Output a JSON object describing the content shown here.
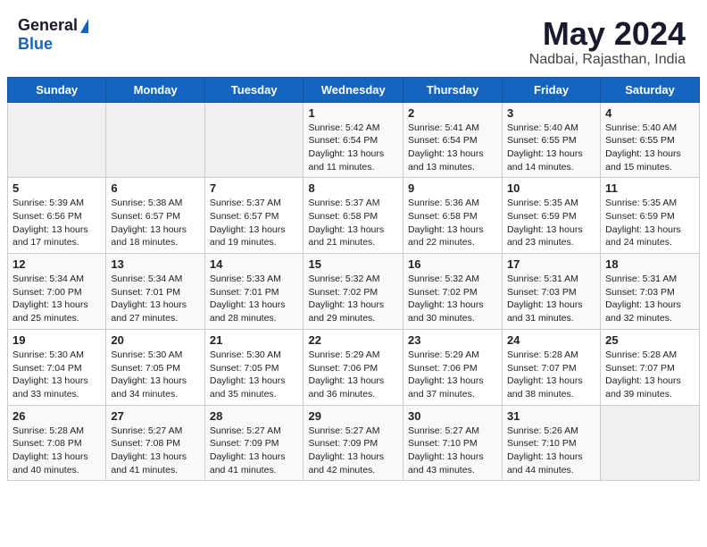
{
  "header": {
    "logo_general": "General",
    "logo_blue": "Blue",
    "title": "May 2024",
    "subtitle": "Nadbai, Rajasthan, India"
  },
  "weekdays": [
    "Sunday",
    "Monday",
    "Tuesday",
    "Wednesday",
    "Thursday",
    "Friday",
    "Saturday"
  ],
  "weeks": [
    [
      {
        "day": "",
        "info": ""
      },
      {
        "day": "",
        "info": ""
      },
      {
        "day": "",
        "info": ""
      },
      {
        "day": "1",
        "info": "Sunrise: 5:42 AM\nSunset: 6:54 PM\nDaylight: 13 hours\nand 11 minutes."
      },
      {
        "day": "2",
        "info": "Sunrise: 5:41 AM\nSunset: 6:54 PM\nDaylight: 13 hours\nand 13 minutes."
      },
      {
        "day": "3",
        "info": "Sunrise: 5:40 AM\nSunset: 6:55 PM\nDaylight: 13 hours\nand 14 minutes."
      },
      {
        "day": "4",
        "info": "Sunrise: 5:40 AM\nSunset: 6:55 PM\nDaylight: 13 hours\nand 15 minutes."
      }
    ],
    [
      {
        "day": "5",
        "info": "Sunrise: 5:39 AM\nSunset: 6:56 PM\nDaylight: 13 hours\nand 17 minutes."
      },
      {
        "day": "6",
        "info": "Sunrise: 5:38 AM\nSunset: 6:57 PM\nDaylight: 13 hours\nand 18 minutes."
      },
      {
        "day": "7",
        "info": "Sunrise: 5:37 AM\nSunset: 6:57 PM\nDaylight: 13 hours\nand 19 minutes."
      },
      {
        "day": "8",
        "info": "Sunrise: 5:37 AM\nSunset: 6:58 PM\nDaylight: 13 hours\nand 21 minutes."
      },
      {
        "day": "9",
        "info": "Sunrise: 5:36 AM\nSunset: 6:58 PM\nDaylight: 13 hours\nand 22 minutes."
      },
      {
        "day": "10",
        "info": "Sunrise: 5:35 AM\nSunset: 6:59 PM\nDaylight: 13 hours\nand 23 minutes."
      },
      {
        "day": "11",
        "info": "Sunrise: 5:35 AM\nSunset: 6:59 PM\nDaylight: 13 hours\nand 24 minutes."
      }
    ],
    [
      {
        "day": "12",
        "info": "Sunrise: 5:34 AM\nSunset: 7:00 PM\nDaylight: 13 hours\nand 25 minutes."
      },
      {
        "day": "13",
        "info": "Sunrise: 5:34 AM\nSunset: 7:01 PM\nDaylight: 13 hours\nand 27 minutes."
      },
      {
        "day": "14",
        "info": "Sunrise: 5:33 AM\nSunset: 7:01 PM\nDaylight: 13 hours\nand 28 minutes."
      },
      {
        "day": "15",
        "info": "Sunrise: 5:32 AM\nSunset: 7:02 PM\nDaylight: 13 hours\nand 29 minutes."
      },
      {
        "day": "16",
        "info": "Sunrise: 5:32 AM\nSunset: 7:02 PM\nDaylight: 13 hours\nand 30 minutes."
      },
      {
        "day": "17",
        "info": "Sunrise: 5:31 AM\nSunset: 7:03 PM\nDaylight: 13 hours\nand 31 minutes."
      },
      {
        "day": "18",
        "info": "Sunrise: 5:31 AM\nSunset: 7:03 PM\nDaylight: 13 hours\nand 32 minutes."
      }
    ],
    [
      {
        "day": "19",
        "info": "Sunrise: 5:30 AM\nSunset: 7:04 PM\nDaylight: 13 hours\nand 33 minutes."
      },
      {
        "day": "20",
        "info": "Sunrise: 5:30 AM\nSunset: 7:05 PM\nDaylight: 13 hours\nand 34 minutes."
      },
      {
        "day": "21",
        "info": "Sunrise: 5:30 AM\nSunset: 7:05 PM\nDaylight: 13 hours\nand 35 minutes."
      },
      {
        "day": "22",
        "info": "Sunrise: 5:29 AM\nSunset: 7:06 PM\nDaylight: 13 hours\nand 36 minutes."
      },
      {
        "day": "23",
        "info": "Sunrise: 5:29 AM\nSunset: 7:06 PM\nDaylight: 13 hours\nand 37 minutes."
      },
      {
        "day": "24",
        "info": "Sunrise: 5:28 AM\nSunset: 7:07 PM\nDaylight: 13 hours\nand 38 minutes."
      },
      {
        "day": "25",
        "info": "Sunrise: 5:28 AM\nSunset: 7:07 PM\nDaylight: 13 hours\nand 39 minutes."
      }
    ],
    [
      {
        "day": "26",
        "info": "Sunrise: 5:28 AM\nSunset: 7:08 PM\nDaylight: 13 hours\nand 40 minutes."
      },
      {
        "day": "27",
        "info": "Sunrise: 5:27 AM\nSunset: 7:08 PM\nDaylight: 13 hours\nand 41 minutes."
      },
      {
        "day": "28",
        "info": "Sunrise: 5:27 AM\nSunset: 7:09 PM\nDaylight: 13 hours\nand 41 minutes."
      },
      {
        "day": "29",
        "info": "Sunrise: 5:27 AM\nSunset: 7:09 PM\nDaylight: 13 hours\nand 42 minutes."
      },
      {
        "day": "30",
        "info": "Sunrise: 5:27 AM\nSunset: 7:10 PM\nDaylight: 13 hours\nand 43 minutes."
      },
      {
        "day": "31",
        "info": "Sunrise: 5:26 AM\nSunset: 7:10 PM\nDaylight: 13 hours\nand 44 minutes."
      },
      {
        "day": "",
        "info": ""
      }
    ]
  ]
}
